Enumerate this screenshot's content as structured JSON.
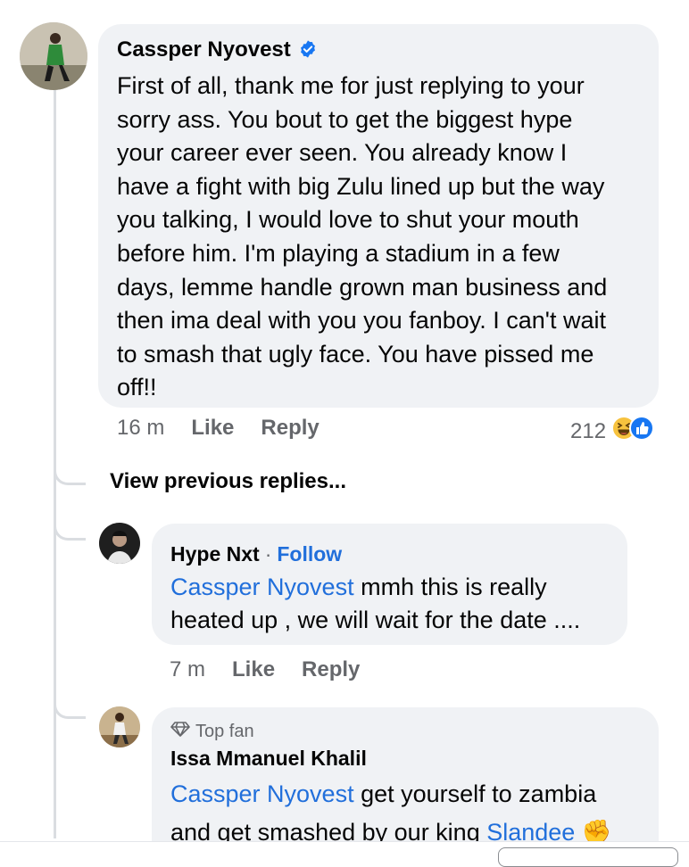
{
  "comment": {
    "author": "Cassper Nyovest",
    "verified": true,
    "text_lines": [
      "First of all, thank me for just replying to your",
      "sorry ass. You bout to get the biggest hype",
      "your career ever seen. You already know I",
      "have a fight with big Zulu lined up but the way",
      "you talking, I would love to shut your mouth",
      "before him. I'm playing a stadium in a few",
      "days, lemme handle grown man business and",
      "then ima deal with you you fanboy. I can't wait",
      "to smash that ugly face. You have pissed me",
      "off!!"
    ],
    "time": "16 m",
    "like_label": "Like",
    "reply_label": "Reply",
    "reaction_count": "212",
    "reaction_icons": [
      "haha-reaction-icon",
      "like-reaction-icon"
    ]
  },
  "view_previous": "View previous replies...",
  "replies": [
    {
      "author": "Hype Nxt",
      "separator": "·",
      "follow_label": "Follow",
      "mention": "Cassper Nyovest",
      "text_line1_rest": " mmh this is really",
      "text_line2": "heated up , we will wait for the date ....",
      "time": "7 m",
      "like_label": "Like",
      "reply_label": "Reply"
    },
    {
      "badge": "Top fan",
      "author": "Issa Mmanuel Khalil",
      "mention": "Cassper Nyovest",
      "text_line1_rest": " get yourself to zambia",
      "text_line2_start": "and get smashed by our king ",
      "mention2": "Slandee",
      "emoji": "✊"
    }
  ],
  "colors": {
    "bubble": "#f0f2f5",
    "link": "#216fdb",
    "meta": "#65676b",
    "verified": "#1877f2"
  }
}
